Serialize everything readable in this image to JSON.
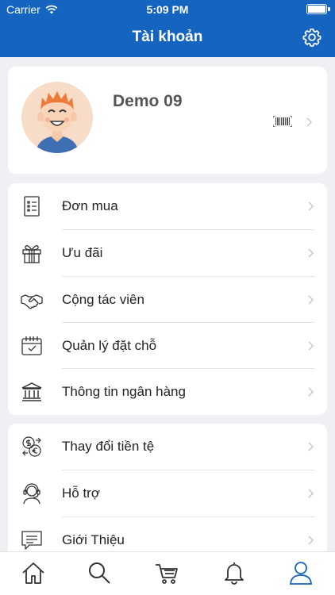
{
  "status_bar": {
    "carrier": "Carrier",
    "time": "5:09 PM"
  },
  "header": {
    "title": "Tài khoản",
    "settings_icon": "gear-icon"
  },
  "profile": {
    "name": "Demo 09",
    "avatar_icon": "user-avatar",
    "barcode_icon": "barcode-icon"
  },
  "menu_main": [
    {
      "label": "Đơn mua",
      "icon": "order-list-icon"
    },
    {
      "label": "Ưu đãi",
      "icon": "gift-icon"
    },
    {
      "label": "Cộng tác viên",
      "icon": "handshake-icon"
    },
    {
      "label": "Quản lý đặt chỗ",
      "icon": "calendar-check-icon"
    },
    {
      "label": "Thông tin ngân hàng",
      "icon": "bank-icon"
    }
  ],
  "menu_other": [
    {
      "label": "Thay đổi tiền tệ",
      "icon": "currency-exchange-icon"
    },
    {
      "label": "Hỗ trợ",
      "icon": "support-agent-icon"
    },
    {
      "label": "Giới Thiệu",
      "icon": "chat-info-icon"
    }
  ],
  "tab_bar": [
    {
      "name": "home",
      "icon": "home-icon"
    },
    {
      "name": "search",
      "icon": "search-icon"
    },
    {
      "name": "cart",
      "icon": "cart-icon"
    },
    {
      "name": "notifications",
      "icon": "bell-icon"
    },
    {
      "name": "account",
      "icon": "user-icon",
      "active": true
    }
  ],
  "colors": {
    "brand": "#1565c0",
    "active_tab": "#1565c0",
    "icon": "#333333"
  }
}
